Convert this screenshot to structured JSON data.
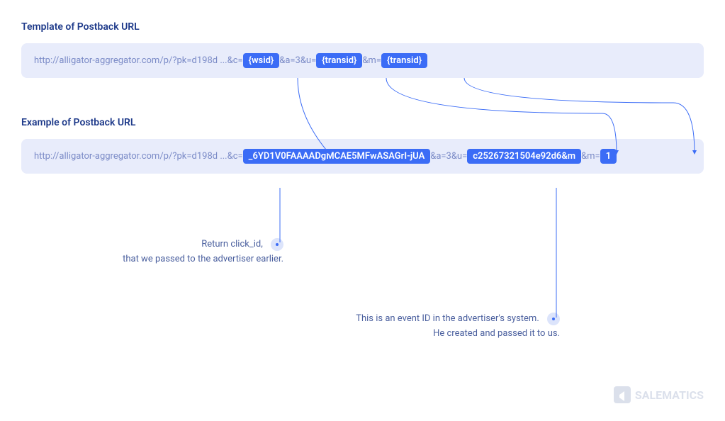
{
  "template": {
    "heading": "Template of Postback URL",
    "base": "http://alligator-aggregator.com/p/?pk=d198d ...",
    "parts": {
      "c_label": " &c=",
      "wsid": "{wsid}",
      "a_u_label": " &a=3&u=",
      "transid1": "{transid}",
      "m_label": " &m=",
      "transid2": "{transid}"
    }
  },
  "example": {
    "heading": "Example of Postback URL",
    "base": "http://alligator-aggregator.com/p/?pk=d198d ...",
    "parts": {
      "c_label": " &c=",
      "wsid_val": "_6YD1V0FAAAADgMCAE5MFwASAGrI-jUA",
      "a_u_label": " &a=3&u=",
      "transid_val": "c25267321504e92d6&m",
      "m_label": " &m=",
      "m_val": "1"
    }
  },
  "annotations": {
    "click": {
      "line1": "Return click_id,",
      "line2": "that we passed to the advertiser earlier."
    },
    "event": {
      "line1": "This is an event ID in the advertiser's system.",
      "line2": "He created and passed it to us."
    }
  },
  "brand": "SALEMATICS"
}
